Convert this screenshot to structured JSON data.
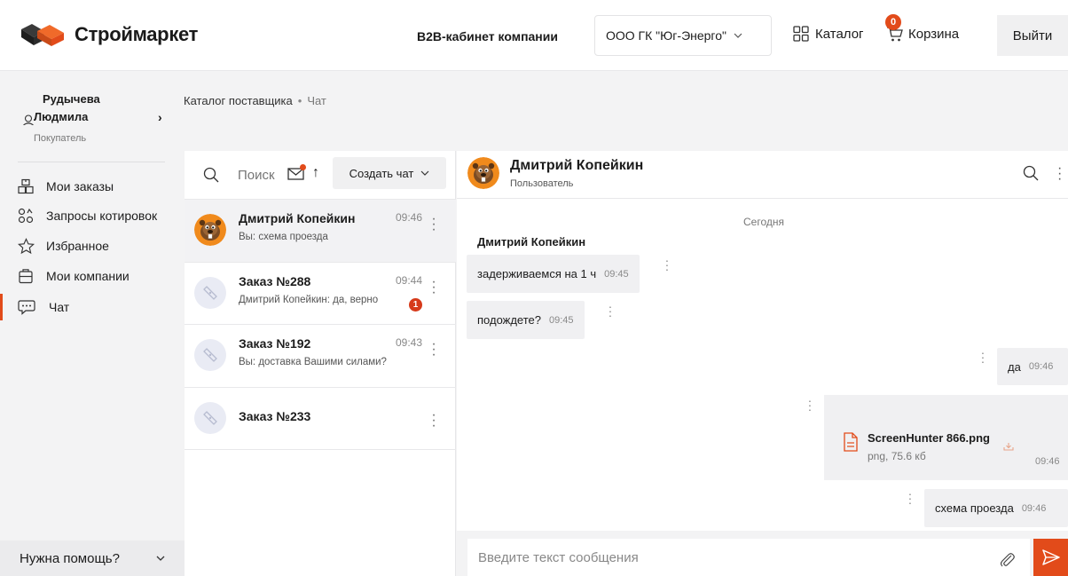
{
  "header": {
    "brand": "Строймаркет",
    "b2b_title": "B2B-кабинет компании",
    "company_selected": "ООО ГК \"Юг-Энерго\"",
    "catalog_label": "Каталог",
    "cart_label": "Корзина",
    "cart_count": "0",
    "logout_label": "Выйти",
    "accent_color": "#e24b1a"
  },
  "user": {
    "first_line": "Рудычева",
    "second_line": "Людмила",
    "role": "Покупатель"
  },
  "sidebar": {
    "items": [
      {
        "label": "Мои заказы",
        "icon": "orders-icon"
      },
      {
        "label": "Запросы котировок",
        "icon": "quotes-icon"
      },
      {
        "label": "Избранное",
        "icon": "star-icon"
      },
      {
        "label": "Мои компании",
        "icon": "company-icon"
      },
      {
        "label": "Чат",
        "icon": "chat-icon",
        "active": true
      }
    ],
    "help_label": "Нужна помощь?"
  },
  "breadcrumb": {
    "parent": "Каталог поставщика",
    "separator": "•",
    "current": "Чат"
  },
  "chat_list": {
    "search_placeholder": "Поиск",
    "create_chat_label": "Создать чат",
    "sort_glyph": "↑",
    "items": [
      {
        "title": "Дмитрий Копейкин",
        "time": "09:46",
        "preview": "Вы: схема проезда",
        "avatar": "beaver-avatar",
        "selected": true
      },
      {
        "title": "Заказ №288",
        "time": "09:44",
        "preview": "Дмитрий Копейкин: да, верно",
        "avatar": "ticket-icon",
        "unread": "1"
      },
      {
        "title": "Заказ №192",
        "time": "09:43",
        "preview": "Вы: доставка Вашими силами?",
        "avatar": "ticket-icon"
      },
      {
        "title": "Заказ №233",
        "time": "",
        "preview": "",
        "avatar": "ticket-icon"
      }
    ]
  },
  "conversation": {
    "name": "Дмитрий Копейкин",
    "role": "Пользователь",
    "date_separator": "Сегодня",
    "sender_label": "Дмитрий Копейкин",
    "messages": [
      {
        "text": "задерживаемся на 1 ч",
        "time": "09:45",
        "direction": "incoming"
      },
      {
        "text": "подождете?",
        "time": "09:45",
        "direction": "incoming"
      },
      {
        "text": "да",
        "time": "09:46",
        "direction": "outgoing"
      },
      {
        "file_name": "ScreenHunter 866.png",
        "file_meta": "png, 75.6 кб",
        "time": "09:46",
        "direction": "outgoing"
      },
      {
        "text": "схема проезда",
        "time": "09:46",
        "direction": "outgoing"
      }
    ],
    "input_placeholder": "Введите текст сообщения"
  }
}
